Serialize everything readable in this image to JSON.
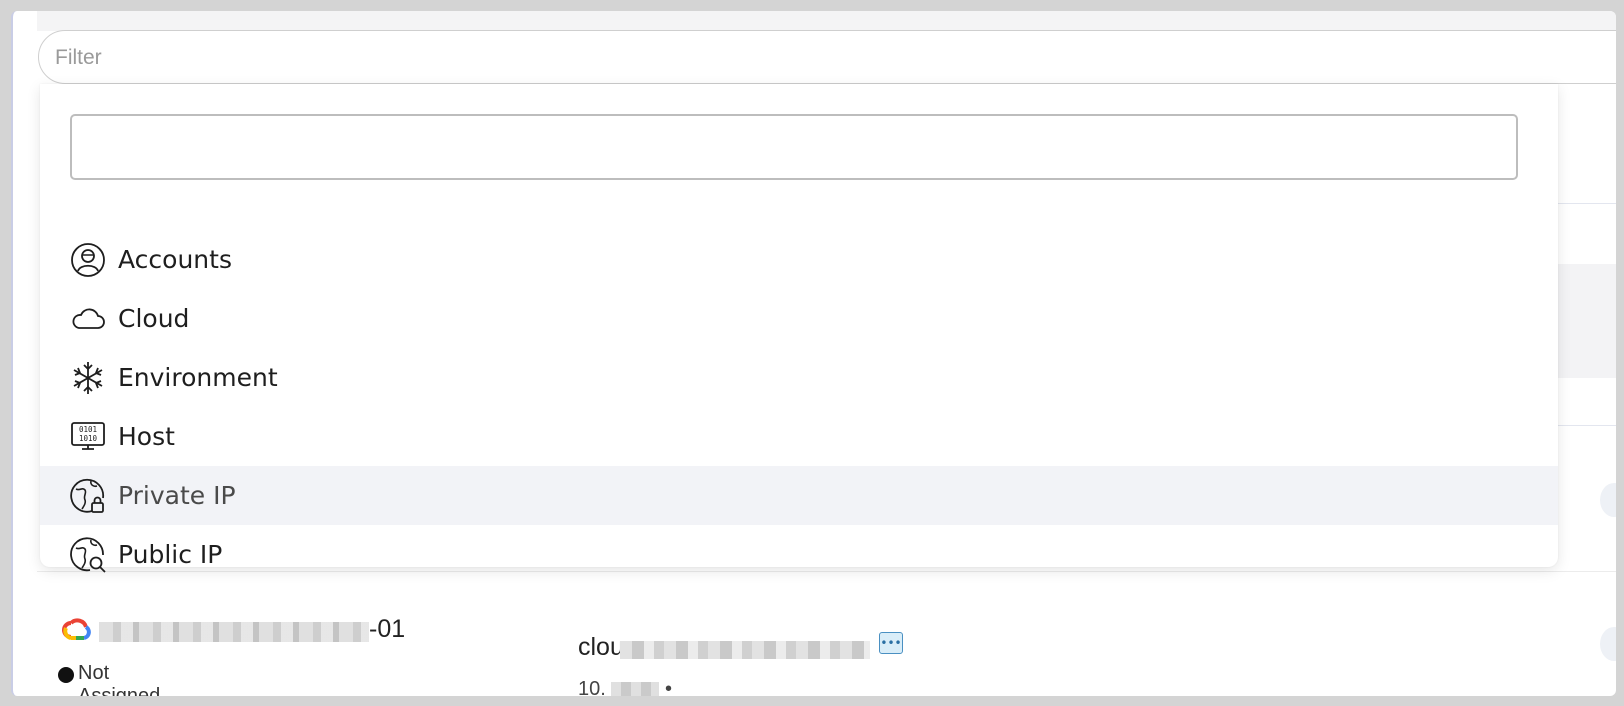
{
  "filter": {
    "placeholder": "Filter"
  },
  "dropdown": {
    "search_value": "",
    "options": [
      {
        "label": "Accounts",
        "icon": "user-circle-icon"
      },
      {
        "label": "Cloud",
        "icon": "cloud-icon"
      },
      {
        "label": "Environment",
        "icon": "snowflake-icon"
      },
      {
        "label": "Host",
        "icon": "binary-monitor-icon"
      },
      {
        "label": "Private IP",
        "icon": "globe-lock-icon",
        "highlighted": true
      },
      {
        "label": "Public IP",
        "icon": "globe-search-icon"
      }
    ]
  },
  "background_row": {
    "name_suffix": "-01",
    "status": "Not Assigned",
    "host_prefix": "clou",
    "ip_prefix": "10.",
    "ip_sep": "• -",
    "more_button": "•••",
    "status_color": "#111111",
    "provider_icon": "google-cloud-icon"
  }
}
